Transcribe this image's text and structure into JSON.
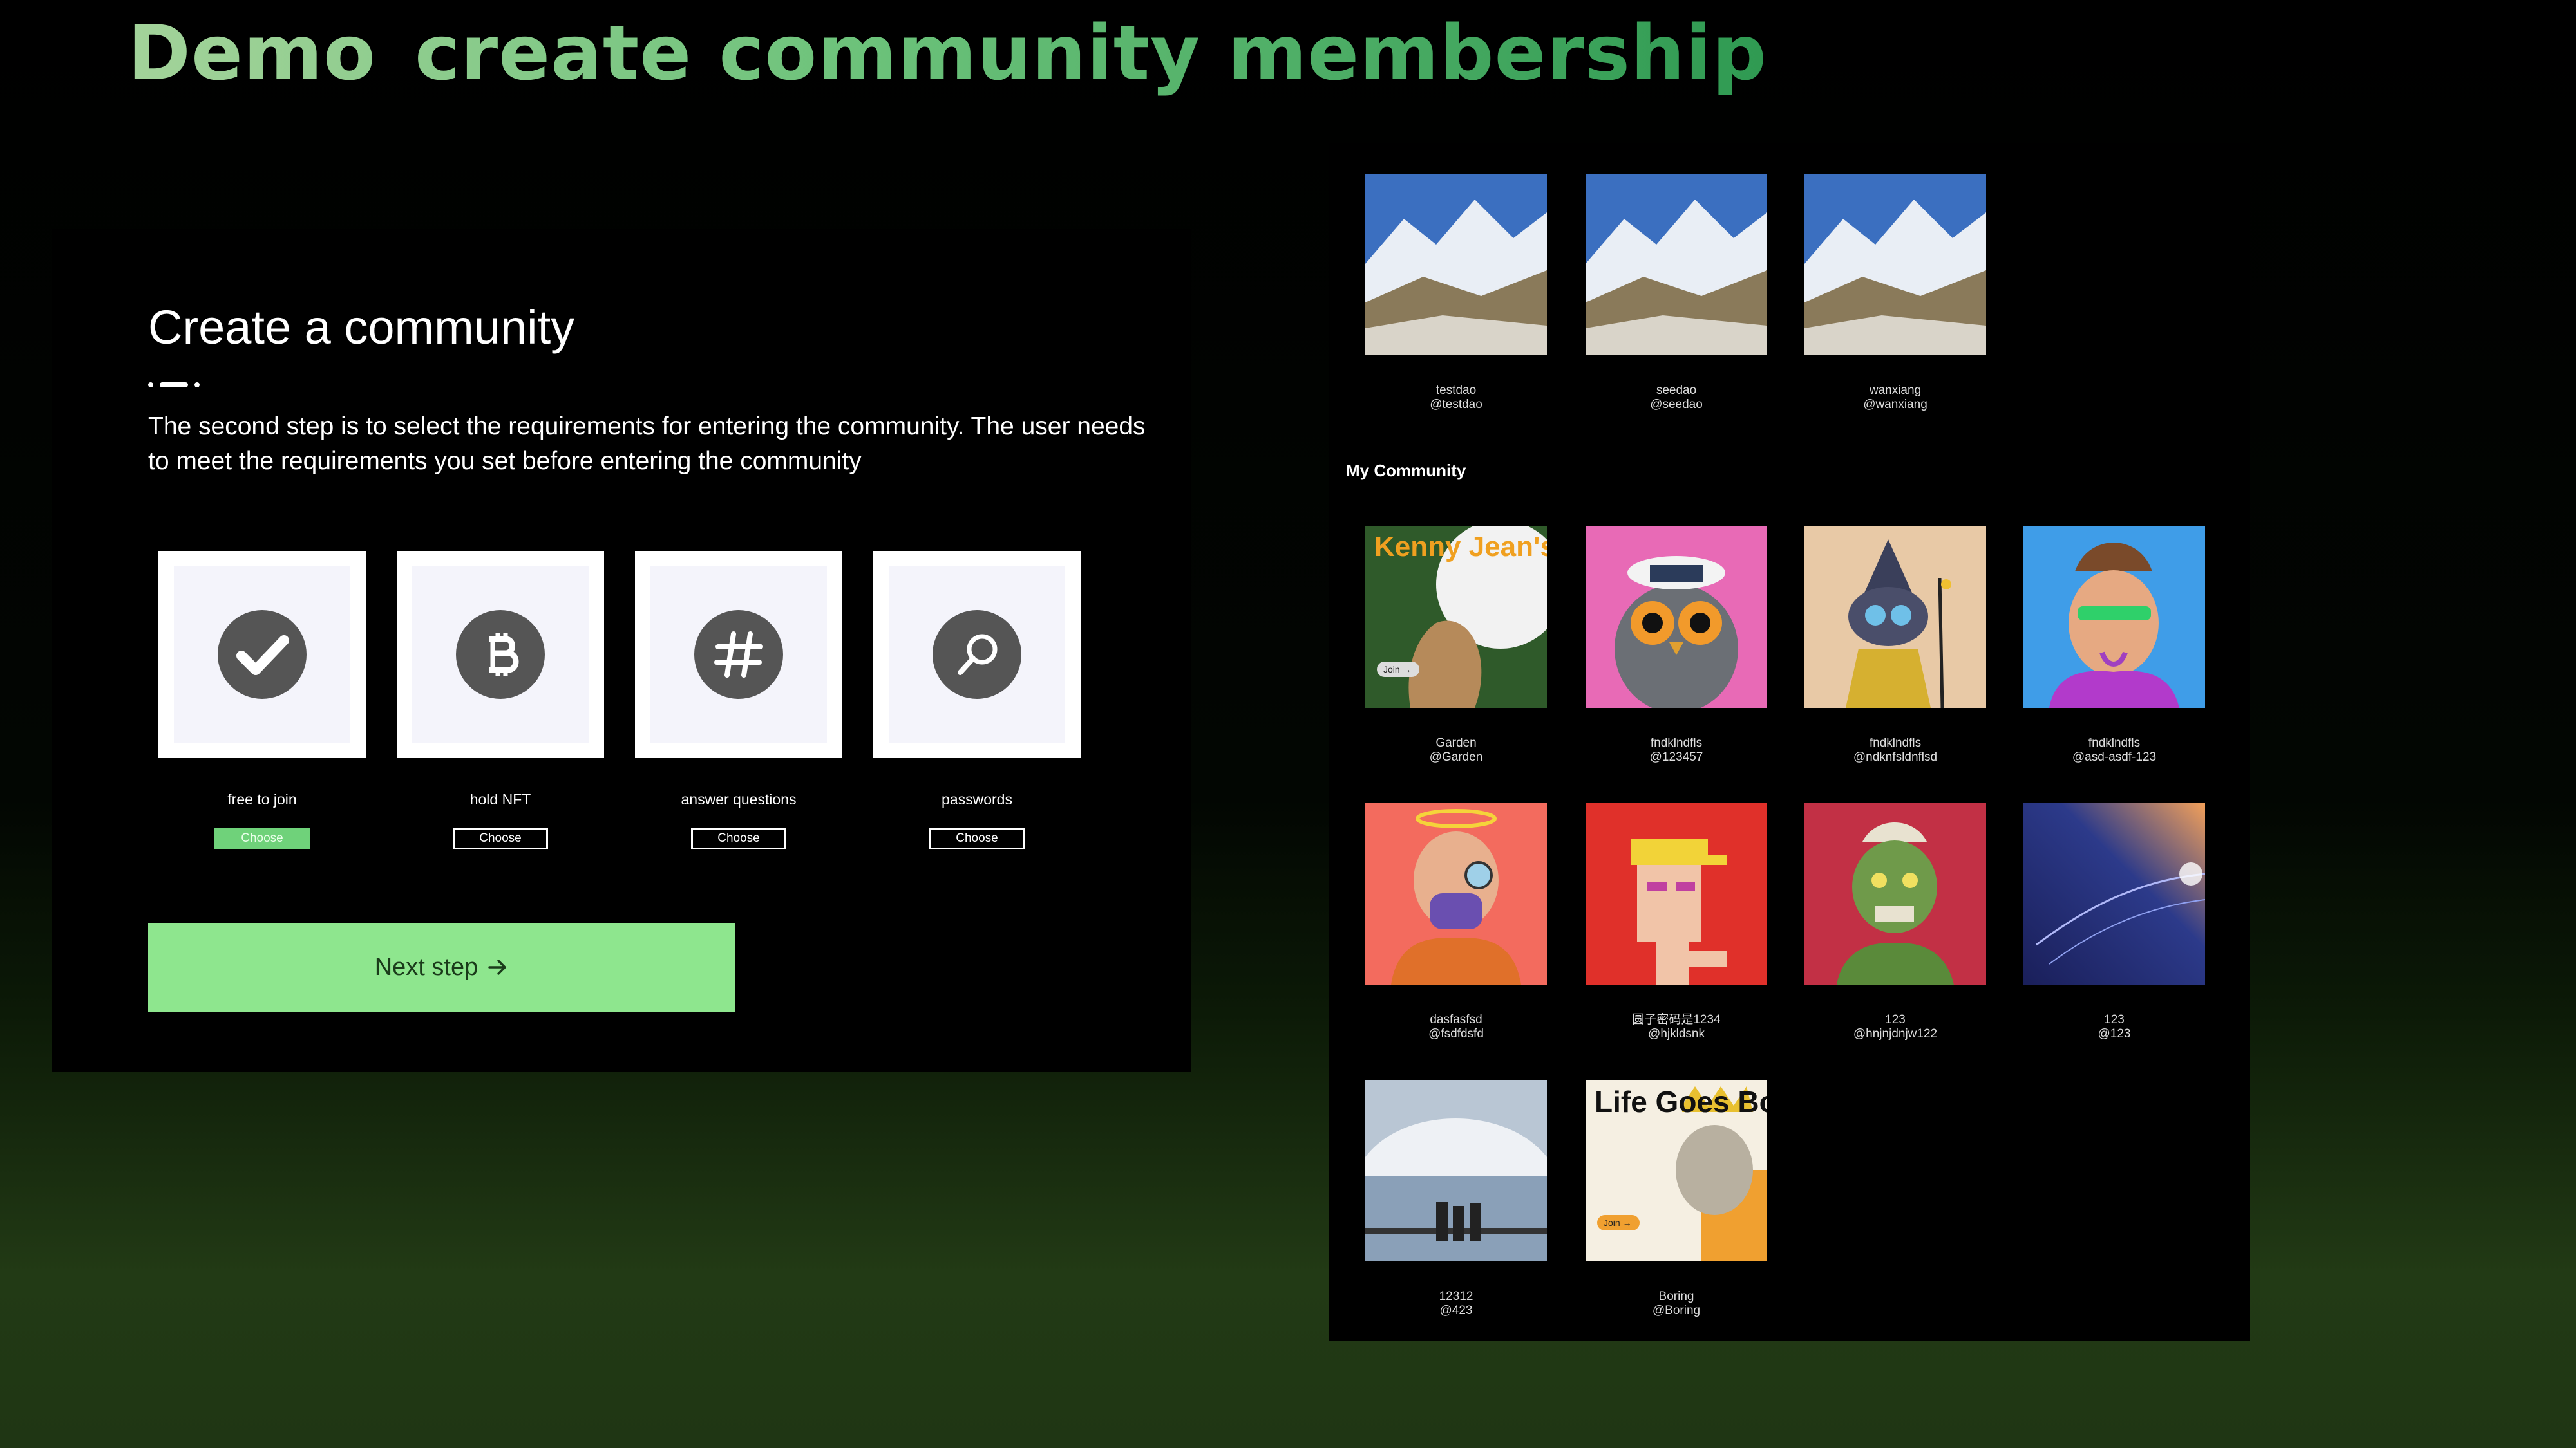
{
  "title": {
    "part1": "Demo",
    "part2": "create community membership"
  },
  "create": {
    "heading": "Create a community",
    "description": "The second step is to select the requirements for entering the community. The user needs to meet the requirements you set before entering the community",
    "options": [
      {
        "label": "free to join",
        "button": "Choose",
        "icon": "check-icon",
        "selected": true
      },
      {
        "label": "hold NFT",
        "button": "Choose",
        "icon": "bitcoin-icon",
        "selected": false
      },
      {
        "label": "answer questions",
        "button": "Choose",
        "icon": "hashtag-icon",
        "selected": false
      },
      {
        "label": "passwords",
        "button": "Choose",
        "icon": "search-icon",
        "selected": false
      }
    ],
    "next_step": "Next step",
    "next_icon": "arrow-right-icon"
  },
  "communities": {
    "featured": [
      {
        "name": "testdao",
        "handle": "@testdao"
      },
      {
        "name": "seedao",
        "handle": "@seedao"
      },
      {
        "name": "wanxiang",
        "handle": "@wanxiang"
      }
    ],
    "my_heading": "My Community",
    "mine": [
      {
        "name": "Garden",
        "handle": "@Garden",
        "art_text": "Kenny Jean's Garden",
        "join": "Join →"
      },
      {
        "name": "fndklndfls",
        "handle": "@123457"
      },
      {
        "name": "fndklndfls",
        "handle": "@ndknfsldnflsd"
      },
      {
        "name": "fndklndfls",
        "handle": "@asd-asdf-123"
      },
      {
        "name": "dasfasfsd",
        "handle": "@fsdfdsfd"
      },
      {
        "name": "圆子密码是1234",
        "handle": "@hjkldsnk"
      },
      {
        "name": "123",
        "handle": "@hnjnjdnjw122"
      },
      {
        "name": "123",
        "handle": "@123"
      },
      {
        "name": "12312",
        "handle": "@423"
      },
      {
        "name": "Boring",
        "handle": "@Boring",
        "art_text": "Life Goes Boring",
        "join": "Join →"
      }
    ]
  },
  "colors": {
    "accent": "#8ee68e",
    "selected": "#6fd27a",
    "panel": "#000000"
  }
}
